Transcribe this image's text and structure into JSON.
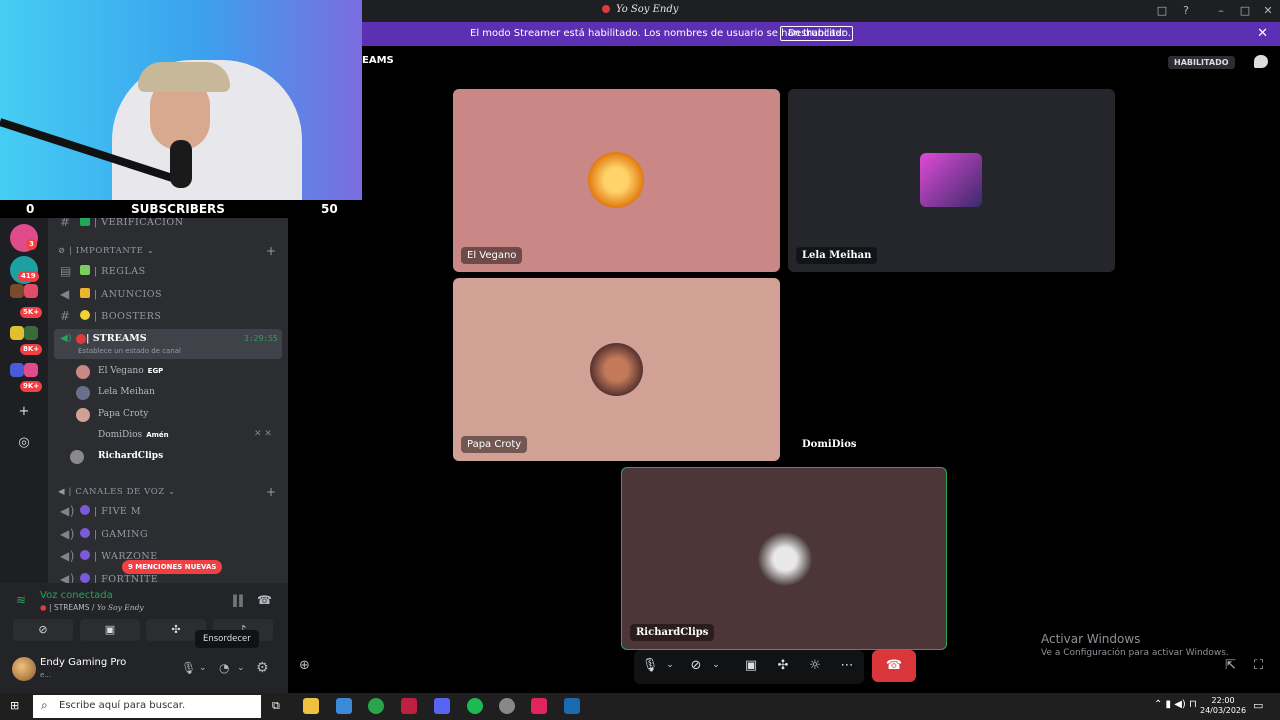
{
  "window": {
    "title": "Yo Soy Endy",
    "controls": [
      "□",
      "?",
      "–",
      "□",
      "✕"
    ]
  },
  "banner": {
    "text": "El modo Streamer está habilitado. Los nombres de usuario se han truncado.",
    "button": "Deshabilitar",
    "close": "✕"
  },
  "header": {
    "channel": "EAMS",
    "badge": "HABILITADO"
  },
  "webcam": {
    "left_count": "0",
    "label": "SUBSCRIBERS",
    "right_count": "50"
  },
  "rail": {
    "badges": [
      "3",
      "419",
      "5K+",
      "8K+",
      "9K+"
    ],
    "add_icon": "+",
    "discover_icon": "◎"
  },
  "sidebar": {
    "channels_top": [
      {
        "name": "| VERIFICACION",
        "emoji_color": "#23a55a"
      }
    ],
    "category_importante": "IMPORTANTE",
    "channels": [
      {
        "name": "| REGLAS",
        "emoji_color": "#7ccf5a"
      },
      {
        "name": "| ANUNCIOS",
        "emoji_color": "#f0b232"
      },
      {
        "name": "| BOOSTERS",
        "emoji_color": "#f0d232"
      }
    ],
    "active_channel": {
      "name": "| STREAMS",
      "subtitle": "Establece un estado de canal",
      "time": "3:29:55"
    },
    "voice_users": [
      {
        "name": "El Vegano",
        "tag": "EGP"
      },
      {
        "name": "Lela Meihan",
        "tag": ""
      },
      {
        "name": "Papa Croty",
        "tag": ""
      },
      {
        "name": "DomiDios",
        "tag": "Amén"
      },
      {
        "name": "RichardClips",
        "tag": ""
      }
    ],
    "category_voz": "CANALES DE VOZ",
    "voice_channels": [
      {
        "name": "| FIVE M"
      },
      {
        "name": "| GAMING"
      },
      {
        "name": "| WARZONE"
      },
      {
        "name": "| FORTNITE"
      }
    ],
    "mentions": "9 MENCIONES NUEVAS"
  },
  "voicepanel": {
    "status": "Voz conectada",
    "channel": "| STREAMS / ",
    "server": "Yo Soy Endy",
    "user": "Endy Gaming Pro",
    "user_sub": "e...",
    "tooltip": "Ensordecer"
  },
  "tiles": [
    {
      "name": "El Vegano",
      "bg": "#c98785"
    },
    {
      "name": "Lela Meihan",
      "bg": "#24262c"
    },
    {
      "name": "Papa Croty",
      "bg": "#d0a194"
    },
    {
      "name": "DomiDios",
      "bg": "#000000"
    },
    {
      "name": "RichardClips",
      "bg": "#4c3637"
    }
  ],
  "watermark": {
    "line1": "Activar Windows",
    "line2": "Ve a Configuración para activar Windows."
  },
  "taskbar": {
    "search_placeholder": "Escribe aquí para buscar.",
    "time": "22:00",
    "date": "24/03/2026"
  }
}
